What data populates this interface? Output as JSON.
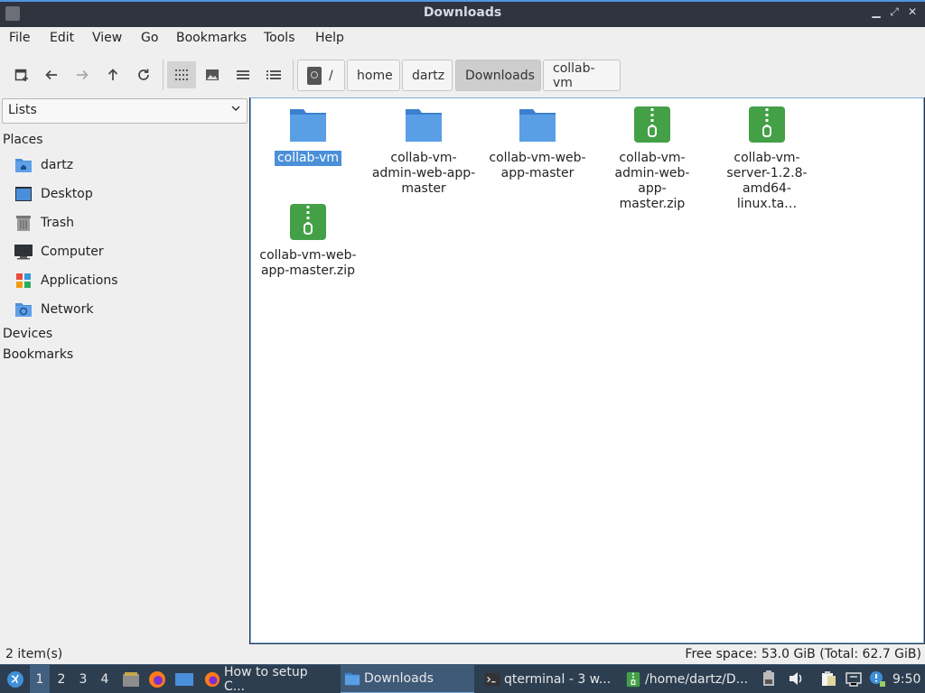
{
  "window": {
    "title": "Downloads",
    "controls": [
      "minimize",
      "restore",
      "close"
    ]
  },
  "menubar": {
    "items": [
      "File",
      "Edit",
      "View",
      "Go",
      "Bookmarks",
      "Tools",
      "Help"
    ]
  },
  "toolbar": {
    "buttons": [
      "new-tab-icon",
      "back-icon",
      "forward-icon",
      "up-icon",
      "reload-icon",
      "icon-view-icon",
      "thumbnail-view-icon",
      "compact-view-icon",
      "detailed-list-icon"
    ],
    "breadcrumbs": [
      "/",
      "home",
      "dartz",
      "Downloads",
      "collab-vm"
    ],
    "current_crumb": "Downloads"
  },
  "sidebar": {
    "mode": "Lists",
    "places_header": "Places",
    "places": [
      {
        "label": "dartz",
        "icon": "home-folder-icon"
      },
      {
        "label": "Desktop",
        "icon": "desktop-icon"
      },
      {
        "label": "Trash",
        "icon": "trash-icon"
      },
      {
        "label": "Computer",
        "icon": "computer-icon"
      },
      {
        "label": "Applications",
        "icon": "applications-icon"
      },
      {
        "label": "Network",
        "icon": "network-folder-icon"
      }
    ],
    "devices_header": "Devices",
    "bookmarks_header": "Bookmarks"
  },
  "files": [
    {
      "name": "collab-vm",
      "type": "folder",
      "selected": true
    },
    {
      "name": "collab-vm-admin-web-app-master",
      "type": "folder",
      "selected": false
    },
    {
      "name": "collab-vm-web-app-master",
      "type": "folder",
      "selected": false
    },
    {
      "name": "collab-vm-admin-web-app-master.zip",
      "type": "archive",
      "selected": false
    },
    {
      "name": "collab-vm-server-1.2.8-amd64-linux.ta…",
      "type": "archive",
      "selected": false
    },
    {
      "name": "collab-vm-web-app-master.zip",
      "type": "archive",
      "selected": false
    }
  ],
  "statusbar": {
    "selection": "2 item(s)",
    "free_space": "Free space: 53.0 GiB (Total: 62.7 GiB)"
  },
  "taskbar": {
    "desktops": [
      "1",
      "2",
      "3",
      "4"
    ],
    "active_desktop": "1",
    "tasks": [
      {
        "label": "How to setup C...",
        "icon": "firefox-icon"
      },
      {
        "label": "Downloads",
        "icon": "folder-icon"
      },
      {
        "label": "qterminal - 3 w...",
        "icon": "terminal-icon"
      },
      {
        "label": "/home/dartz/D...",
        "icon": "archive-icon"
      }
    ],
    "active_task": "Downloads",
    "clock": "9:50"
  },
  "colors": {
    "accent": "#4a90d9",
    "folder": "#4a8fdb",
    "archive": "#4caf50",
    "taskbar": "#2c3e50"
  }
}
